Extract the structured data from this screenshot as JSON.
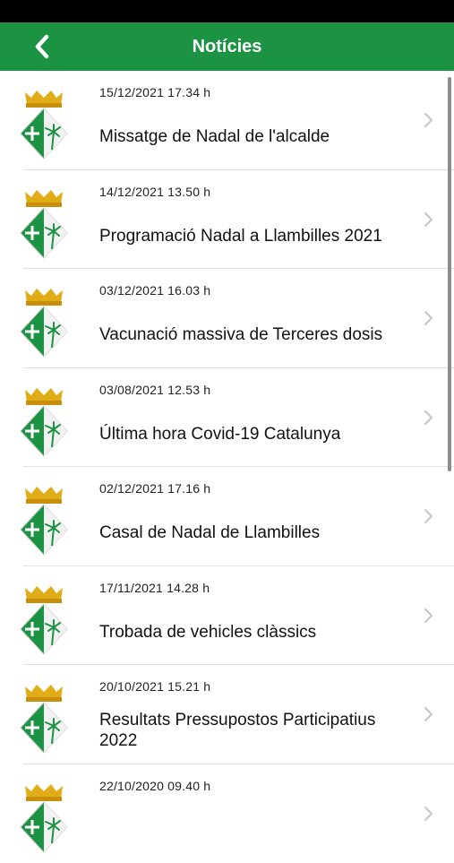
{
  "header": {
    "title": "Notícies",
    "back_icon": "chevron-left-icon"
  },
  "colors": {
    "accent": "#1b9342",
    "crown": "#e0ac17",
    "separator": "#e1e1e1"
  },
  "news": [
    {
      "date": "15/12/2021 17.34 h",
      "title": "Missatge de Nadal de l'alcalde"
    },
    {
      "date": "14/12/2021 13.50 h",
      "title": "Programació Nadal a Llambilles 2021"
    },
    {
      "date": "03/12/2021 16.03 h",
      "title": "Vacunació massiva de Terceres dosis"
    },
    {
      "date": "03/08/2021 12.53 h",
      "title": "Última hora Covid-19 Catalunya"
    },
    {
      "date": "02/12/2021 17.16 h",
      "title": "Casal de Nadal de Llambilles"
    },
    {
      "date": "17/11/2021 14.28 h",
      "title": "Trobada de vehicles clàssics"
    },
    {
      "date": "20/10/2021 15.21 h",
      "title": "Resultats Pressupostos Participatius 2022"
    },
    {
      "date": "22/10/2020 09.40 h",
      "title": ""
    }
  ]
}
